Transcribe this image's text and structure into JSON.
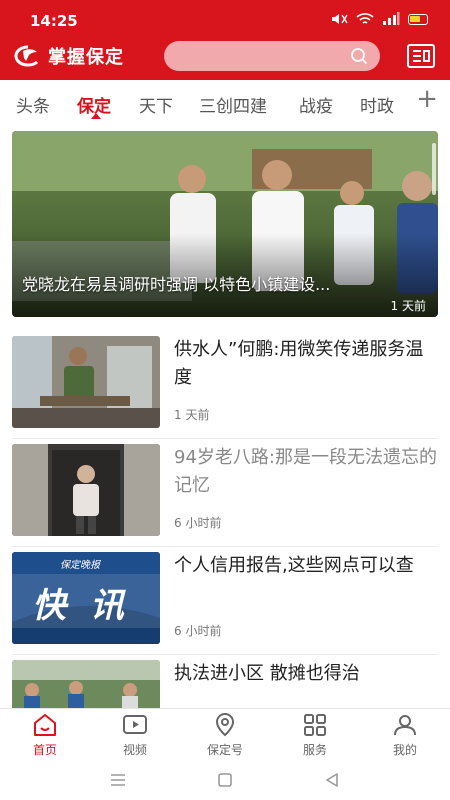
{
  "status": {
    "time": "14:25"
  },
  "header": {
    "title": "掌握保定",
    "search": {
      "placeholder": ""
    }
  },
  "tabs": [
    {
      "label": "头条"
    },
    {
      "label": "保定",
      "active": true
    },
    {
      "label": "天下"
    },
    {
      "label": "三创四建"
    },
    {
      "label": "战疫"
    },
    {
      "label": "时政"
    }
  ],
  "feature": {
    "title": "党晓龙在易县调研时强调 以特色小镇建设...",
    "time": "1 天前"
  },
  "news": [
    {
      "title": "供水人”何鹏:用微笑传递服务温度",
      "time": "1 天前",
      "read": false
    },
    {
      "title": "94岁老八路:那是一段无法遗忘的记忆",
      "time": "6 小时前",
      "read": true
    },
    {
      "title": "个人信用报告,这些网点可以查",
      "time": "6 小时前",
      "read": false,
      "thumb_text": "快 讯",
      "thumb_caption": "保定晚报"
    },
    {
      "title": "执法进小区 散摊也得治",
      "time": "",
      "read": false
    }
  ],
  "bottom_nav": [
    {
      "label": "首页",
      "icon": "home-icon",
      "active": true
    },
    {
      "label": "视频",
      "icon": "video-icon"
    },
    {
      "label": "保定号",
      "icon": "location-icon"
    },
    {
      "label": "服务",
      "icon": "grid-icon"
    },
    {
      "label": "我的",
      "icon": "user-icon"
    }
  ],
  "colors": {
    "brand": "#d8141c",
    "search_bg": "#f2a9ab"
  }
}
